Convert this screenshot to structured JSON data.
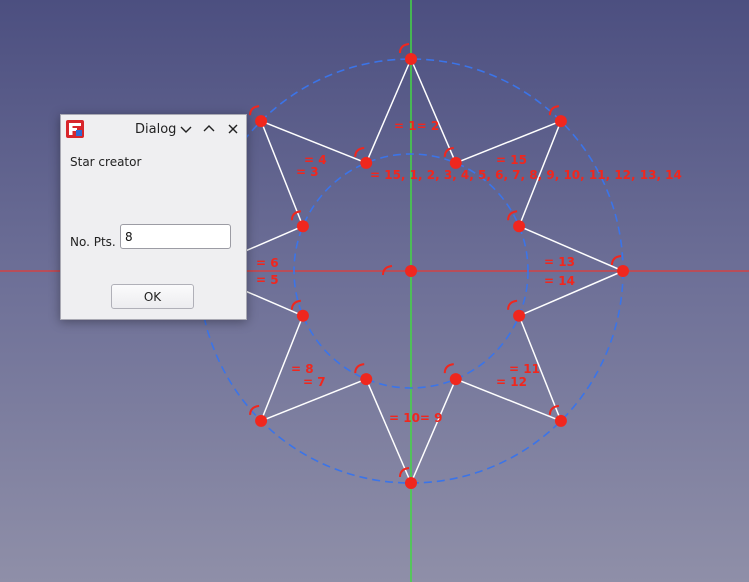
{
  "dialog": {
    "title": "Dialog",
    "heading": "Star creator",
    "points_label": "No. Pts.",
    "points_value": "8",
    "ok_label": "OK",
    "icons": [
      "freecad-logo-icon",
      "chevron-down-icon",
      "chevron-up-icon",
      "close-icon"
    ]
  },
  "sketch": {
    "colors": {
      "vertex": "#f0271e",
      "edge": "#ffffff",
      "construction_circle": "#3b74e8",
      "x_axis": "#e53935",
      "y_axis": "#43d843",
      "constraint_label": "#f0271e"
    },
    "constraint_labels": [
      "= 1= 2",
      "= 15",
      "= 4",
      "= 3",
      "= 15, 1, 2, 3, 4, 5, 6, 7, 8, 9, 10, 11, 12, 13, 14",
      "= 6",
      "= 5",
      "= 13",
      "= 14",
      "= 8",
      "= 7",
      "= 11",
      "= 12",
      "= 10= 9"
    ]
  }
}
